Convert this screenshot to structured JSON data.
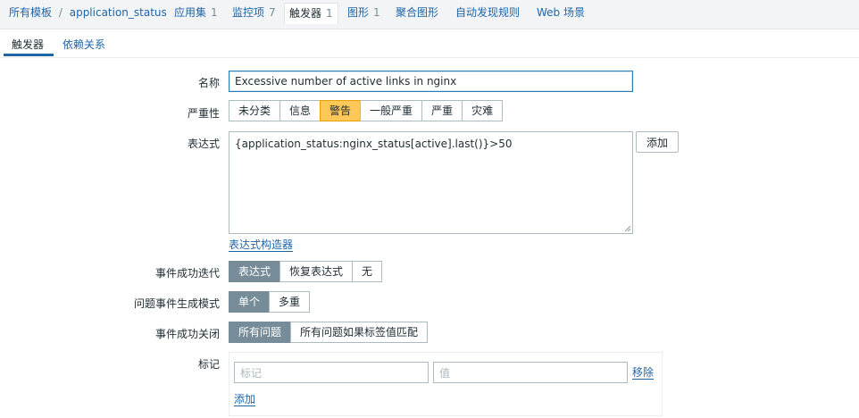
{
  "breadcrumb": {
    "all_templates": "所有模板",
    "separator": "/",
    "template_name": "application_status"
  },
  "nav": {
    "apps": {
      "label": "应用集",
      "count": "1"
    },
    "items": {
      "label": "监控项",
      "count": "7"
    },
    "triggers": {
      "label": "触发器",
      "count": "1"
    },
    "graphs": {
      "label": "图形",
      "count": "1"
    },
    "screens": {
      "label": "聚合图形"
    },
    "discovery": {
      "label": "自动发现规则"
    },
    "web": {
      "label": "Web 场景"
    }
  },
  "tabs": {
    "trigger": "触发器",
    "dependencies": "依赖关系"
  },
  "form": {
    "name_label": "名称",
    "name_value": "Excessive number of active links in nginx",
    "severity_label": "严重性",
    "severity_options": [
      "未分类",
      "信息",
      "警告",
      "一般严重",
      "严重",
      "灾难"
    ],
    "severity_selected": "警告",
    "expression_label": "表达式",
    "expression_value": "{application_status:nginx_status[active].last()}>50",
    "add_button": "添加",
    "expression_constructor": "表达式构造器",
    "ok_event_gen_label": "事件成功迭代",
    "ok_event_gen_options": [
      "表达式",
      "恢复表达式",
      "无"
    ],
    "ok_event_gen_selected": "表达式",
    "problem_mode_label": "问题事件生成模式",
    "problem_mode_options": [
      "单个",
      "多重"
    ],
    "problem_mode_selected": "单个",
    "ok_close_label": "事件成功关闭",
    "ok_close_options": [
      "所有问题",
      "所有问题如果标签值匹配"
    ],
    "ok_close_selected": "所有问题",
    "tags_label": "标记",
    "tag_placeholder": "标记",
    "value_placeholder": "值",
    "remove_link": "移除",
    "add_link": "添加"
  },
  "colors": {
    "link": "#1f65a8",
    "warning_selected": "#ffc859",
    "segment_selected": "#768d99"
  }
}
